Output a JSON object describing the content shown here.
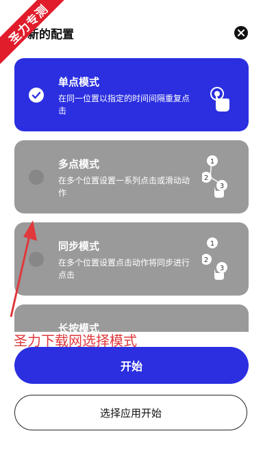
{
  "header": {
    "title": "新的配置"
  },
  "ribbon": {
    "text": "圣力专测"
  },
  "modes": [
    {
      "title": "单点模式",
      "description": "在同一位置以指定的时间间隔重复点击",
      "selected": true
    },
    {
      "title": "多点模式",
      "description": "在多个位置设置一系列点击或滑动动作",
      "selected": false
    },
    {
      "title": "同步模式",
      "description": "在多个位置设置点击动作将同步进行点击",
      "selected": false
    },
    {
      "title": "长按模式",
      "description": "",
      "selected": false
    }
  ],
  "overlay": {
    "text": "圣力下载网选择模式"
  },
  "buttons": {
    "start": "开始",
    "choose_app": "选择应用开始"
  },
  "icons": {
    "close": "close-icon",
    "check": "check-icon",
    "tap": "tap-hand-icon",
    "multi": "multi-tap-icon"
  },
  "colors": {
    "accent": "#2b2fe0",
    "card_gray": "#9a9a9a",
    "ribbon": "#e11d2b"
  }
}
